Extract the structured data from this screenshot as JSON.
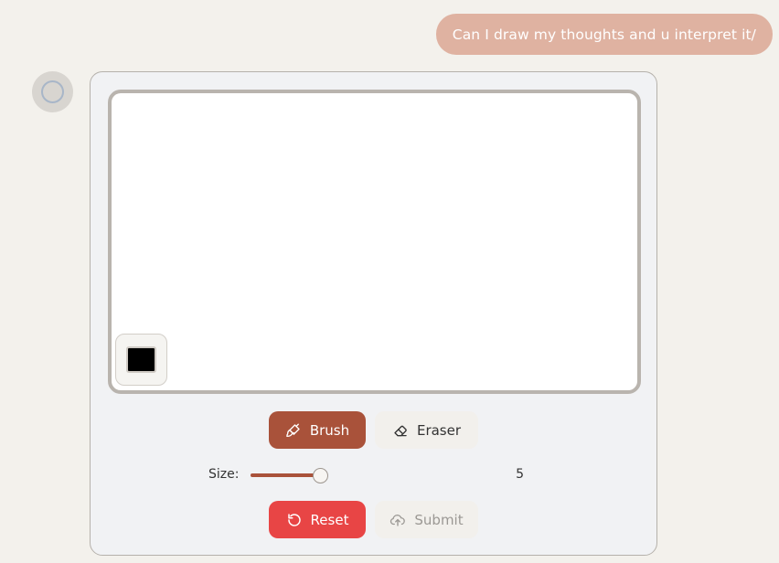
{
  "chat": {
    "user_message": "Can I draw my thoughts and u interpret it/"
  },
  "widget": {
    "color": {
      "current": "#000000"
    },
    "tools": {
      "brush_label": "Brush",
      "eraser_label": "Eraser",
      "active": "brush"
    },
    "size": {
      "label": "Size:",
      "value": "5",
      "fraction": 0.9
    },
    "actions": {
      "reset_label": "Reset",
      "submit_label": "Submit"
    },
    "colors": {
      "accent": "#a9523a",
      "reset": "#e84545",
      "user_bubble": "#dfb2a1"
    },
    "icons": [
      "brush-icon",
      "eraser-icon",
      "reset-icon",
      "upload-icon"
    ]
  }
}
